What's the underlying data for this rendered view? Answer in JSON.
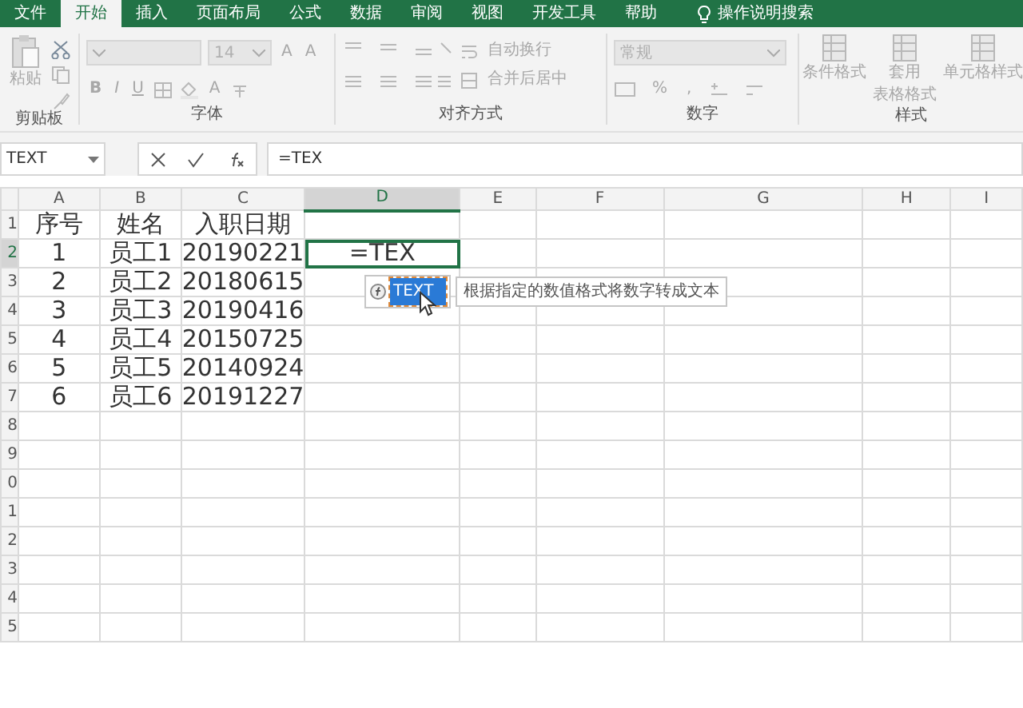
{
  "tabs": [
    {
      "label": "文件",
      "selected": false
    },
    {
      "label": "开始",
      "selected": true
    },
    {
      "label": "插入",
      "selected": false
    },
    {
      "label": "页面布局",
      "selected": false
    },
    {
      "label": "公式",
      "selected": false
    },
    {
      "label": "数据",
      "selected": false
    },
    {
      "label": "审阅",
      "selected": false
    },
    {
      "label": "视图",
      "selected": false
    },
    {
      "label": "开发工具",
      "selected": false
    },
    {
      "label": "帮助",
      "selected": false
    }
  ],
  "search": {
    "label": "操作说明搜索"
  },
  "ribbon": {
    "groups": [
      {
        "kind": "clipboard",
        "label": "剪贴板",
        "paste": "粘贴"
      },
      {
        "kind": "font",
        "label": "字体",
        "font_size": "14",
        "bold": "B",
        "italic": "I",
        "underline": "U",
        "grow": "A",
        "shrink": "A",
        "font_color": "A"
      },
      {
        "kind": "alignment",
        "label": "对齐方式",
        "wrap": "自动换行",
        "merge": "合并后居中"
      },
      {
        "kind": "number",
        "label": "数字",
        "format": "常规",
        "percent": "%",
        "comma": ","
      },
      {
        "kind": "styles",
        "label": "样式",
        "buttons": [
          {
            "lines": [
              "条件格式"
            ]
          },
          {
            "lines": [
              "套用",
              "表格格式"
            ]
          },
          {
            "lines": [
              "单元格样式"
            ]
          }
        ]
      }
    ]
  },
  "formula_bar": {
    "name_box": "TEXT",
    "formula": "=TEX"
  },
  "sheet": {
    "columns": [
      {
        "label": "A",
        "selected": false
      },
      {
        "label": "B",
        "selected": false
      },
      {
        "label": "C",
        "selected": false
      },
      {
        "label": "D",
        "selected": true
      },
      {
        "label": "E",
        "selected": false
      },
      {
        "label": "F",
        "selected": false
      },
      {
        "label": "G",
        "selected": false
      },
      {
        "label": "H",
        "selected": false
      },
      {
        "label": "I",
        "selected": false
      }
    ],
    "rows": [
      {
        "header": "1",
        "selected": false,
        "cells": [
          "序号",
          "姓名",
          "入职日期"
        ]
      },
      {
        "header": "2",
        "selected": true,
        "cells": [
          "1",
          "员工1",
          "20190221",
          "=TEX"
        ]
      },
      {
        "header": "3",
        "selected": false,
        "cells": [
          "2",
          "员工2",
          "20180615"
        ]
      },
      {
        "header": "4",
        "selected": false,
        "cells": [
          "3",
          "员工3",
          "20190416"
        ]
      },
      {
        "header": "5",
        "selected": false,
        "cells": [
          "4",
          "员工4",
          "20150725"
        ]
      },
      {
        "header": "6",
        "selected": false,
        "cells": [
          "5",
          "员工5",
          "20140924"
        ]
      },
      {
        "header": "7",
        "selected": false,
        "cells": [
          "6",
          "员工6",
          "20191227"
        ]
      },
      {
        "header": "8",
        "selected": false,
        "cells": []
      },
      {
        "header": "9",
        "selected": false,
        "cells": []
      },
      {
        "header": "0",
        "selected": false,
        "cells": []
      },
      {
        "header": "1",
        "selected": false,
        "cells": []
      },
      {
        "header": "2",
        "selected": false,
        "cells": []
      },
      {
        "header": "3",
        "selected": false,
        "cells": []
      },
      {
        "header": "4",
        "selected": false,
        "cells": []
      },
      {
        "header": "5",
        "selected": false,
        "cells": []
      }
    ]
  },
  "autocomplete": {
    "items": [
      {
        "label": "TEXT",
        "selected": true
      }
    ],
    "tooltip": "根据指定的数值格式将数字转成文本"
  }
}
